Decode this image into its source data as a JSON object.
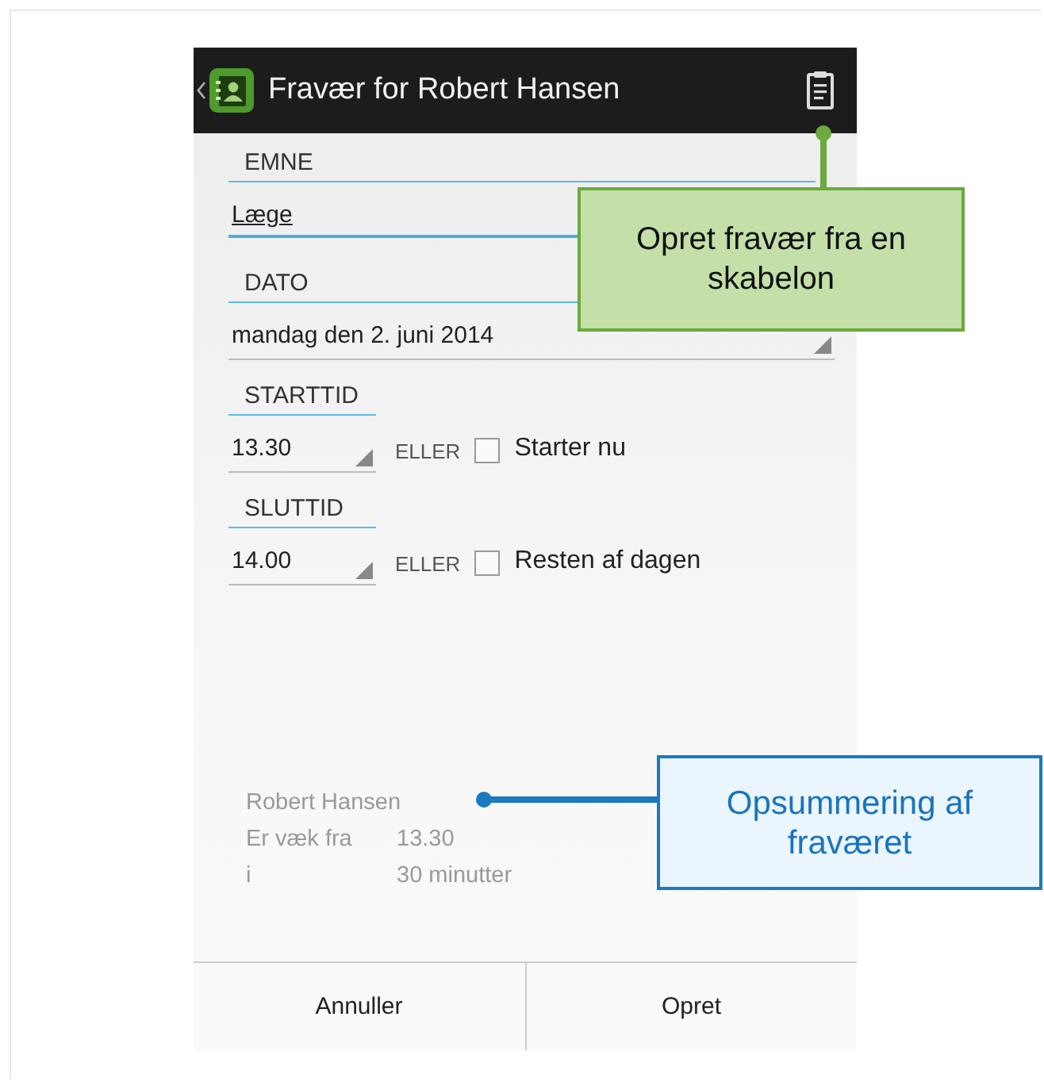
{
  "action_bar": {
    "title": "Fravær for Robert Hansen"
  },
  "form": [
    {
      "kind": "text",
      "label": "EMNE",
      "value": "Læge"
    },
    {
      "kind": "spinner",
      "label": "DATO",
      "value": "mandag den 2. juni 2014"
    },
    {
      "kind": "time",
      "label": "STARTTID",
      "value": "13.30",
      "or": "ELLER",
      "option": {
        "label": "Starter nu",
        "checked": false
      }
    },
    {
      "kind": "time",
      "label": "SLUTTID",
      "value": "14.00",
      "or": "ELLER",
      "option": {
        "label": "Resten af dagen",
        "checked": false
      }
    }
  ],
  "summary": {
    "name": "Robert Hansen",
    "rows": [
      {
        "label": "Er væk fra",
        "value": "13.30"
      },
      {
        "label": "i",
        "value": "30 minutter"
      }
    ]
  },
  "buttons": [
    "Annuller",
    "Opret"
  ],
  "callouts": [
    {
      "kind": "green",
      "text": "Opret fravær fra en skabelon"
    },
    {
      "kind": "blue",
      "text": "Opsummering af fraværet"
    }
  ]
}
